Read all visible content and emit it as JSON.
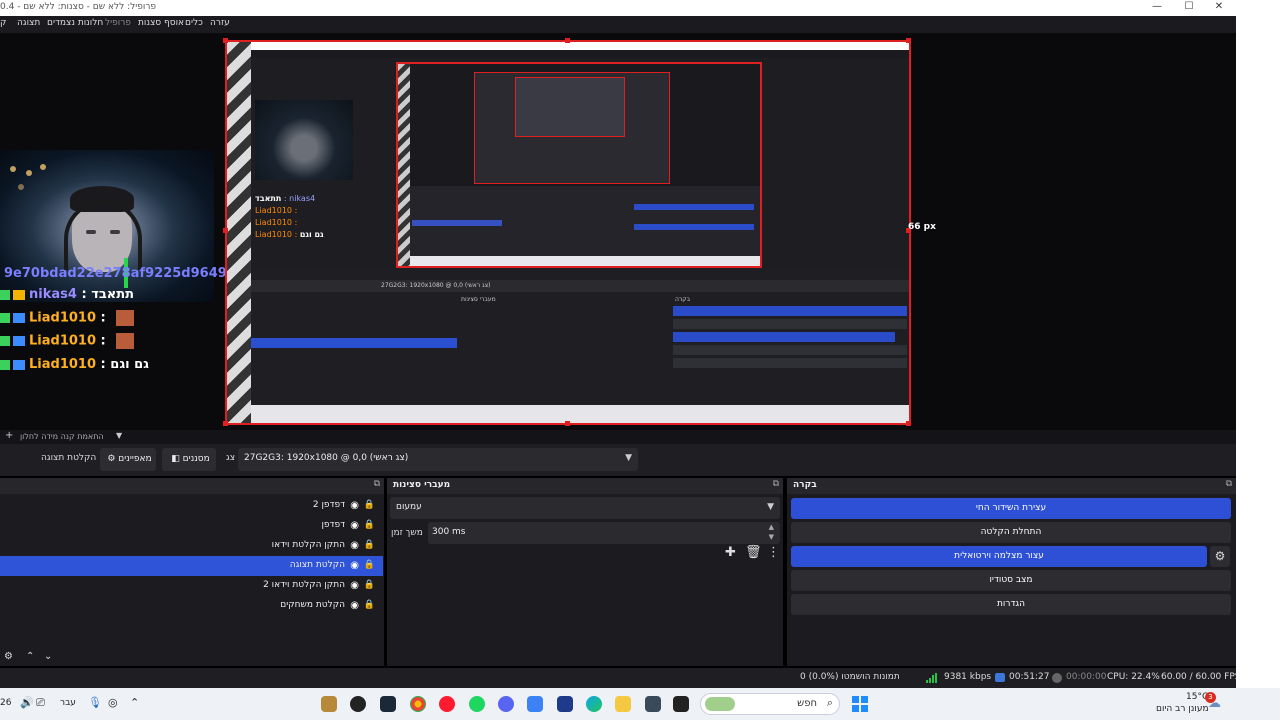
{
  "window": {
    "title": "פרופיל: ללא שם - סצנות: ללא שם - 0.4",
    "controls": [
      "—",
      "☐",
      "✕"
    ]
  },
  "menu": {
    "file": "ק",
    "view": "תצוגה",
    "docks": "חלונות נצמדים",
    "profile": "פרופיל",
    "scene_collection": "אוסף סצנות",
    "tools": "כלים",
    "help": "עזרה"
  },
  "preview": {
    "size_label": "66 px",
    "hash_text": "9e70bdad22e278af9225d9649&amp;",
    "chat": [
      {
        "user": "nikas4",
        "sep": " : ",
        "msg": "תתאבד",
        "badge": "gold"
      },
      {
        "user": "Liad1010",
        "sep": " : ",
        "msg": "",
        "badge": "blue",
        "emote": true
      },
      {
        "user": "Liad1010",
        "sep": " : ",
        "msg": "",
        "badge": "blue",
        "emote": true
      },
      {
        "user": "Liad1010",
        "sep": " : ",
        "msg": "גם וגם",
        "badge": "blue"
      }
    ],
    "nested": {
      "toolbar_label": "27G2G3: 1920x1080 @ 0,0 (צג ראשי)",
      "sources_title": "מעברי סצינות",
      "controls_title": "בקרה"
    }
  },
  "substrip": {
    "text": "התאמת קנה מידה לחלון",
    "plus": "+",
    "chev": "▼"
  },
  "toolbar": {
    "record_label": "הקלטת תצוגה",
    "properties_label": "מאפיינים",
    "filters_label": "מסננים",
    "display_label": "צג",
    "display_value": "27G2G3: 1920x1080 @ 0,0 (צג ראשי)"
  },
  "sources": {
    "items": [
      {
        "name": "דפדפן 2",
        "selected": false
      },
      {
        "name": "דפדפן",
        "selected": false
      },
      {
        "name": "התקן הקלטת וידאו",
        "selected": false
      },
      {
        "name": "הקלטת תצוגה",
        "selected": true
      },
      {
        "name": "התקן הקלטת וידאו 2",
        "selected": false
      },
      {
        "name": "הקלטת משחקים",
        "selected": false
      }
    ],
    "footer": [
      "⚙",
      "⌃",
      "⌄"
    ]
  },
  "transitions": {
    "title": "מעברי סצינות",
    "type": "עמעום",
    "duration_label": "משך זמן",
    "duration_value": "300 ms"
  },
  "controls": {
    "title": "בקרה",
    "start_streaming": "עצירת השידור החי",
    "start_recording": "התחלת הקלטה",
    "virtual_camera": "עצור מצלמה וירטואלית",
    "studio_mode": "מצב סטודיו",
    "settings": "הגדרות"
  },
  "status": {
    "dropped": "0 תמונות הושמטו (0.0%)",
    "bitrate": "9381 kbps",
    "stream_time": "00:51:27",
    "rec_time": "00:00:00",
    "cpu": "CPU: 22.4%",
    "fps": "60.00 / 60.00 FPS"
  },
  "taskbar": {
    "search_placeholder": "חפש",
    "weather_temp": "15°C",
    "weather_desc": "מעונן רב היום",
    "notif_count": "3",
    "lang": "עבר",
    "clock": "26"
  },
  "colors": {
    "accent_blue": "#2d50d6",
    "selection_red": "#e02020",
    "panel_bg": "#1c1c20"
  }
}
